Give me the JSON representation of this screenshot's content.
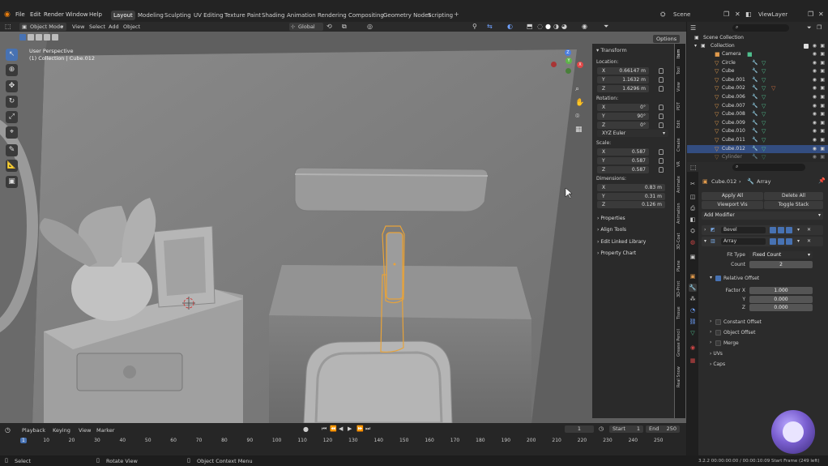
{
  "topbar": {
    "menus": [
      "File",
      "Edit",
      "Render",
      "Window",
      "Help"
    ],
    "workspaces": [
      "Layout",
      "Modeling",
      "Sculpting",
      "UV Editing",
      "Texture Paint",
      "Shading",
      "Animation",
      "Rendering",
      "Compositing",
      "Geometry Nodes",
      "Scripting"
    ],
    "active_workspace": "Layout",
    "scene": "Scene",
    "view_layer": "ViewLayer"
  },
  "viewport_header": {
    "mode": "Object Mode",
    "menus": [
      "View",
      "Select",
      "Add",
      "Object"
    ],
    "orientation": "Global",
    "options": "Options"
  },
  "viewport": {
    "perspective": "User Perspective",
    "collection_info": "(1) Collection | Cube.012",
    "gizmo_axes": [
      "X",
      "Y",
      "Z"
    ]
  },
  "npanel": {
    "transform_title": "Transform",
    "location_label": "Location:",
    "location": {
      "x": "0.66147 m",
      "y": "1.1632 m",
      "z": "1.6296 m"
    },
    "rotation_label": "Rotation:",
    "rotation": {
      "x": "0°",
      "y": "90°",
      "z": "0°"
    },
    "rotation_mode": "XYZ Euler",
    "scale_label": "Scale:",
    "scale": {
      "x": "0.587",
      "y": "0.587",
      "z": "0.587"
    },
    "dimensions_label": "Dimensions:",
    "dimensions": {
      "x": "0.83 m",
      "y": "0.31 m",
      "z": "0.126 m"
    },
    "sections": [
      "Properties",
      "Align Tools",
      "Edit Linked Library",
      "Property Chart"
    ],
    "vertical_tabs": [
      "Item",
      "Tool",
      "View",
      "PDT",
      "Edit",
      "Create",
      "VR",
      "Animate",
      "Animation",
      "3D-Coat",
      "Plane",
      "3D-Print",
      "Tissue",
      "Grease Pencil",
      "Real Snow"
    ]
  },
  "outliner": {
    "root": "Scene Collection",
    "collection": "Collection",
    "items": [
      "Camera",
      "Circle",
      "Cube",
      "Cube.001",
      "Cube.002",
      "Cube.006",
      "Cube.007",
      "Cube.008",
      "Cube.009",
      "Cube.010",
      "Cube.011",
      "Cube.012",
      "Cylinder"
    ],
    "selected": "Cube.012"
  },
  "properties": {
    "object_name": "Cube.012",
    "modifier_crumb": "Array",
    "apply_all": "Apply All",
    "delete_all": "Delete All",
    "viewport_vis": "Viewport Vis",
    "toggle_stack": "Toggle Stack",
    "add_modifier": "Add Modifier",
    "modifiers": [
      "Bevel",
      "Array"
    ],
    "fit_type_label": "Fit Type",
    "fit_type_value": "Fixed Count",
    "count_label": "Count",
    "count_value": "2",
    "relative_offset": "Relative Offset",
    "factor_x_label": "Factor X",
    "factor_x": "1.000",
    "factor_y_label": "Y",
    "factor_y": "0.000",
    "factor_z_label": "Z",
    "factor_z": "0.000",
    "constant_offset": "Constant Offset",
    "object_offset": "Object Offset",
    "merge": "Merge",
    "uvs": "UVs",
    "caps": "Caps"
  },
  "timeline": {
    "menus": [
      "Playback",
      "Keying",
      "View",
      "Marker"
    ],
    "current_frame": "1",
    "start_label": "Start",
    "start": "1",
    "end_label": "End",
    "end": "250",
    "ticks": [
      "1",
      "10",
      "20",
      "30",
      "40",
      "50",
      "60",
      "70",
      "80",
      "90",
      "100",
      "110",
      "120",
      "130",
      "140",
      "150",
      "160",
      "170",
      "180",
      "190",
      "200",
      "210",
      "220",
      "230",
      "240",
      "250"
    ]
  },
  "statusbar": {
    "select": "Select",
    "rotate_view": "Rotate View",
    "context_menu": "Object Context Menu",
    "info": "3.2.2  00:00:00:00 / 00:00:10:09  Start Frame (249 left)"
  },
  "colors": {
    "accent": "#4772b3",
    "selection": "#e8a33a",
    "background": "#1d1d1d"
  }
}
